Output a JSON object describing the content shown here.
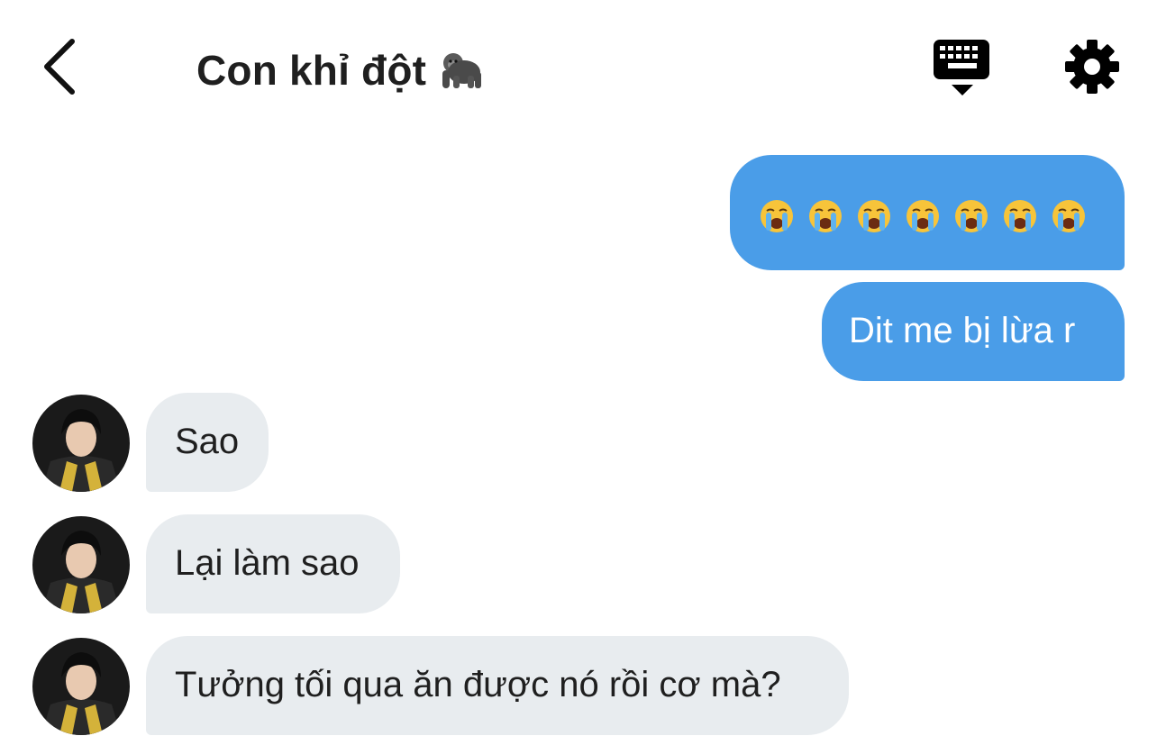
{
  "header": {
    "title": "Con khỉ đột",
    "title_emoji": "gorilla-emoji",
    "back_icon": "chevron-left-icon",
    "keyboard_icon": "keyboard-hide-icon",
    "settings_icon": "gear-icon"
  },
  "messages": [
    {
      "direction": "outgoing",
      "type": "emoji",
      "emoji": "loudly-crying-face",
      "count": 7
    },
    {
      "direction": "outgoing",
      "text": "Dit me bị lừa r"
    },
    {
      "direction": "incoming",
      "text": "Sao"
    },
    {
      "direction": "incoming",
      "text": "Lại làm sao"
    },
    {
      "direction": "incoming",
      "text": "Tưởng tối qua ăn được nó rồi cơ mà?"
    }
  ],
  "colors": {
    "outgoing_bubble": "#4a9de8",
    "incoming_bubble": "#e8ecef",
    "title_text": "#1f1f1f",
    "icon": "#000000"
  }
}
